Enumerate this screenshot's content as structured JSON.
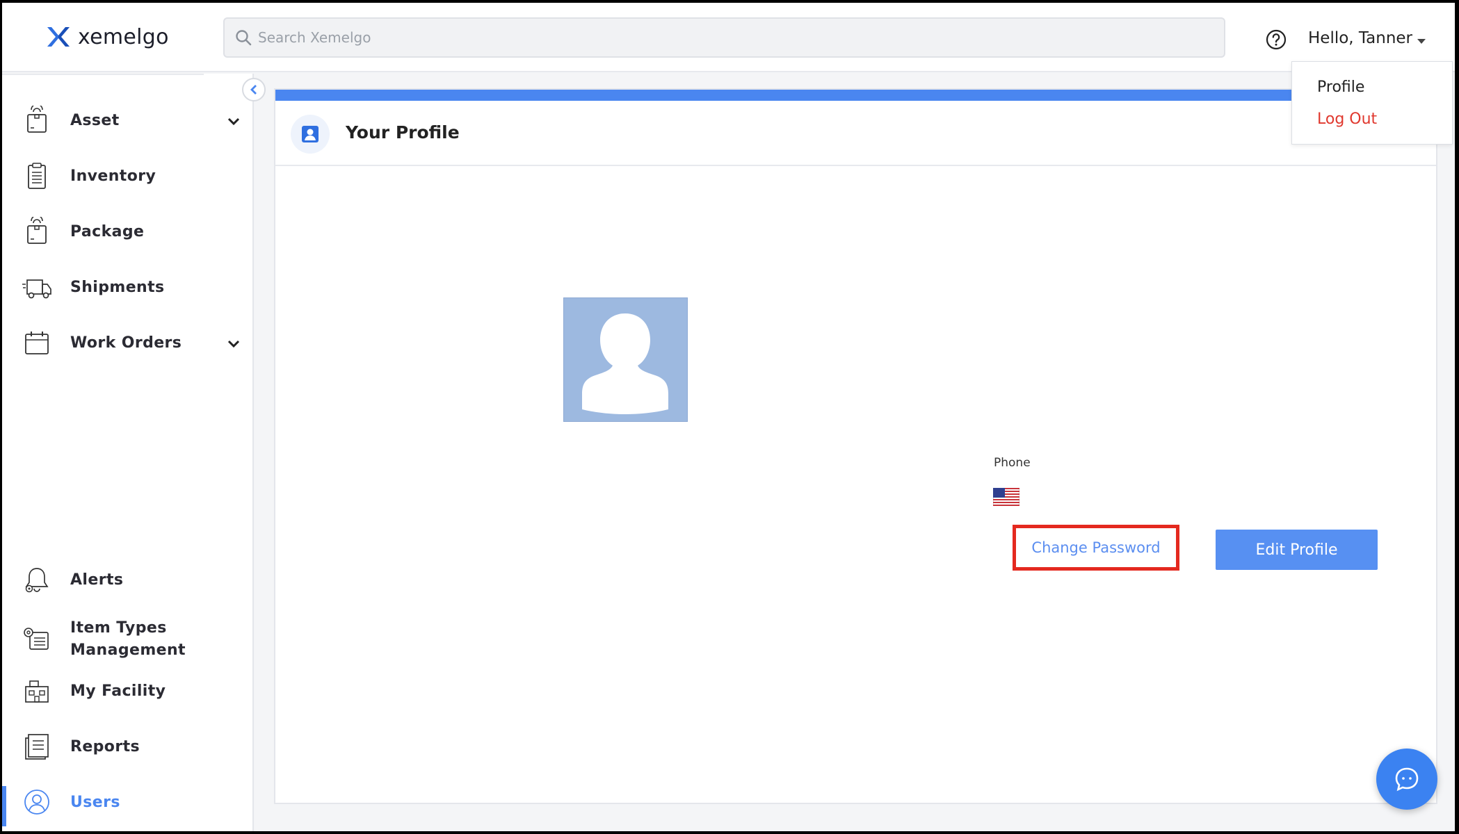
{
  "app": {
    "name": "xemelgo"
  },
  "search": {
    "placeholder": "Search Xemelgo",
    "value": ""
  },
  "header": {
    "greeting": "Hello, Tanner"
  },
  "user_menu": {
    "items": [
      {
        "label": "Profile"
      },
      {
        "label": "Log Out",
        "color": "#e0382e"
      }
    ]
  },
  "sidebar": {
    "items": [
      {
        "label": "Asset",
        "icon": "asset-tag-icon",
        "expandable": true
      },
      {
        "label": "Inventory",
        "icon": "clipboard-icon",
        "expandable": false
      },
      {
        "label": "Package",
        "icon": "package-tag-icon",
        "expandable": false
      },
      {
        "label": "Shipments",
        "icon": "truck-icon",
        "expandable": false
      },
      {
        "label": "Work Orders",
        "icon": "calendar-icon",
        "expandable": true
      },
      {
        "label": "Alerts",
        "icon": "bell-icon",
        "expandable": false
      },
      {
        "label": "Item Types Management",
        "icon": "item-types-icon",
        "expandable": false
      },
      {
        "label": "My Facility",
        "icon": "facility-icon",
        "expandable": false
      },
      {
        "label": "Reports",
        "icon": "reports-icon",
        "expandable": false
      },
      {
        "label": "Users",
        "icon": "user-circle-icon",
        "expandable": false,
        "active": true
      }
    ]
  },
  "profile": {
    "title": "Your Profile",
    "phone_label": "Phone",
    "flag": "us-flag-icon",
    "change_password_label": "Change Password",
    "edit_profile_label": "Edit Profile"
  },
  "colors": {
    "accent": "#4a86f0",
    "danger": "#e0382e",
    "highlight_border": "#e4291f",
    "active_nav": "#4a86f0"
  }
}
